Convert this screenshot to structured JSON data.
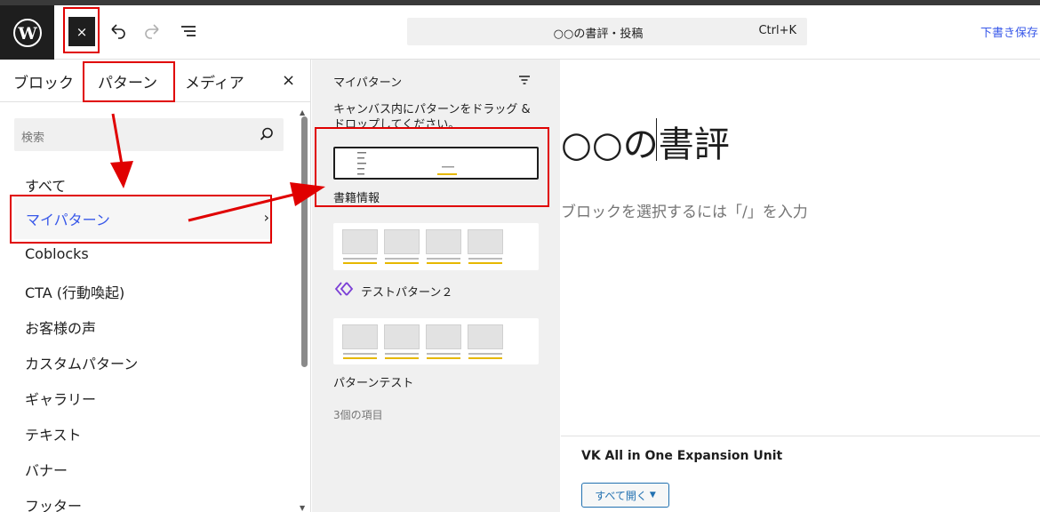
{
  "header": {
    "close_label": "×",
    "command_title": "○○の書評・投稿",
    "command_shortcut": "Ctrl+K",
    "save_draft": "下書き保存",
    "icons": [
      "wordpress-logo-icon",
      "close-icon",
      "undo-icon",
      "redo-icon",
      "document-overview-icon"
    ]
  },
  "sidebar": {
    "tabs": [
      {
        "label": "ブロック"
      },
      {
        "label": "パターン",
        "active": true
      },
      {
        "label": "メディア"
      }
    ],
    "close_label": "×",
    "search_placeholder": "検索",
    "categories": [
      {
        "label": "すべて"
      },
      {
        "label": "マイパターン",
        "active": true
      },
      {
        "label": "Coblocks"
      },
      {
        "label": "CTA (行動喚起)"
      },
      {
        "label": "お客様の声"
      },
      {
        "label": "カスタムパターン"
      },
      {
        "label": "ギャラリー"
      },
      {
        "label": "テキスト"
      },
      {
        "label": "バナー"
      },
      {
        "label": "フッター"
      }
    ],
    "chevron": "›"
  },
  "pattern_panel": {
    "title": "マイパターン",
    "description": "キャンバス内にパターンをドラッグ & ドロップしてください。",
    "patterns": [
      {
        "label": "書籍情報"
      },
      {
        "label": "テストパターン２"
      },
      {
        "label": "パターンテスト"
      }
    ],
    "count": "3個の項目"
  },
  "canvas": {
    "post_title": "○○の書評",
    "block_hint": "ブロックを選択するには「/」を入力"
  },
  "meta_box": {
    "title": "VK All in One Expansion Unit",
    "expand_button": "すべて開く"
  },
  "colors": {
    "accent": "#3858e9",
    "dark": "#1e1e1e",
    "annotation": "#e00000"
  }
}
